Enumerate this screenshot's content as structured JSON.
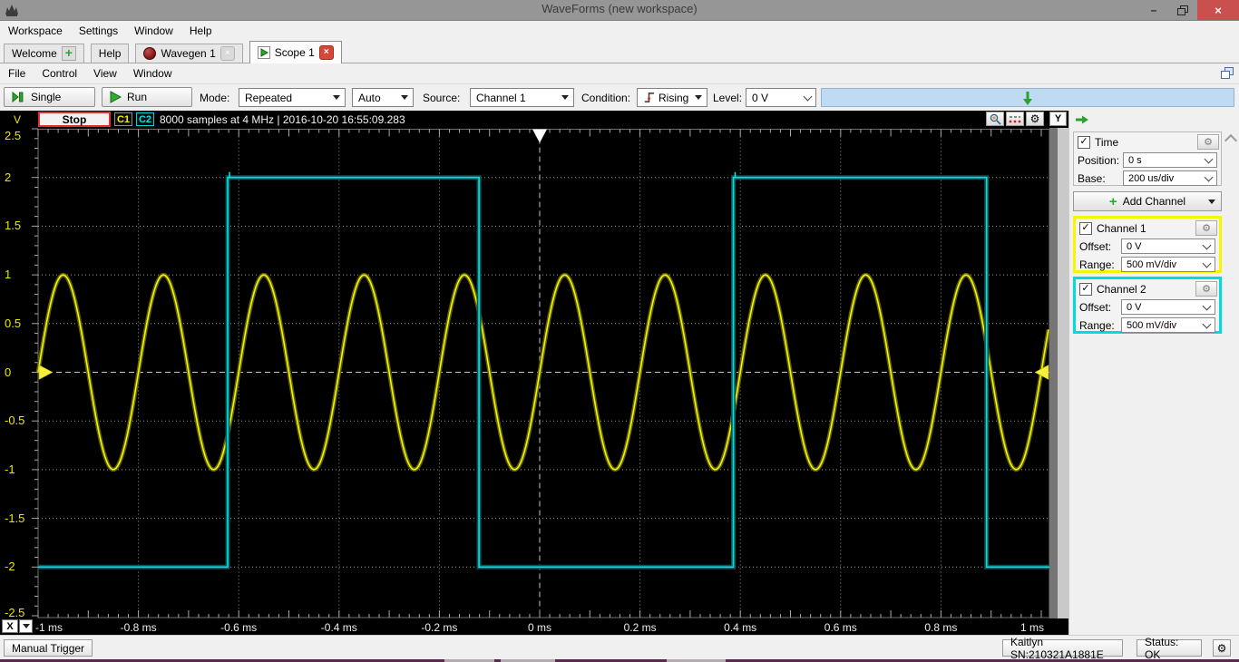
{
  "window": {
    "title": "WaveForms  (new workspace)"
  },
  "icons": {
    "gear": "⚙",
    "check": "✓",
    "plus": "+",
    "play": "▶",
    "close": "×",
    "minimize": "–",
    "dropdown": "▼"
  },
  "menubar": {
    "items": [
      "Workspace",
      "Settings",
      "Window",
      "Help"
    ]
  },
  "tabs": {
    "welcome": "Welcome",
    "help": "Help",
    "wavegen": "Wavegen 1",
    "scope": "Scope 1"
  },
  "scope_menu": {
    "items": [
      "File",
      "Control",
      "View",
      "Window"
    ]
  },
  "toolbar": {
    "single_label": "Single",
    "run_label": "Run",
    "mode_label": "Mode:",
    "mode_value": "Repeated",
    "trigger_mode_value": "Auto",
    "source_label": "Source:",
    "source_value": "Channel 1",
    "condition_label": "Condition:",
    "condition_value": "Rising",
    "level_label": "Level:",
    "level_value": "0 V"
  },
  "scope_header": {
    "stop_label": "Stop",
    "c1_label": "C1",
    "c2_label": "C2",
    "info": "8000 samples at 4 MHz | 2016-10-20 16:55:09.283"
  },
  "right_panel": {
    "time_label": "Time",
    "position_label": "Position:",
    "position_value": "0 s",
    "base_label": "Base:",
    "base_value": "200 us/div",
    "add_channel_label": "Add Channel",
    "ch1": {
      "label": "Channel 1",
      "offset_label": "Offset:",
      "offset_value": "0 V",
      "range_label": "Range:",
      "range_value": "500 mV/div",
      "color": "#f6f600"
    },
    "ch2": {
      "label": "Channel 2",
      "offset_label": "Offset:",
      "offset_value": "0 V",
      "range_label": "Range:",
      "range_value": "500 mV/div",
      "color": "#00dcdc"
    }
  },
  "statusbar": {
    "manual_trigger_label": "Manual Trigger",
    "device_label": "Kaitlyn SN:210321A1881E",
    "status_label": "Status: OK"
  },
  "chart_data": {
    "type": "line",
    "title": "Oscilloscope capture, 2 channels",
    "x_axis": {
      "unit": "ms",
      "min": -1,
      "max": 1,
      "divisions": 10,
      "axis_button": "X",
      "tick_labels": [
        "-1 ms",
        "-0.8 ms",
        "-0.6 ms",
        "-0.4 ms",
        "-0.2 ms",
        "0 ms",
        "0.2 ms",
        "0.4 ms",
        "0.6 ms",
        "0.8 ms",
        "1 ms"
      ]
    },
    "y_axis": {
      "unit": "V",
      "min": -2.5,
      "max": 2.5,
      "divisions": 10,
      "axis_button": "Y",
      "tick_labels": [
        "2.5",
        "2",
        "1.5",
        "1",
        "0.5",
        "0",
        "-0.5",
        "-1",
        "-1.5",
        "-2",
        "-2.5"
      ]
    },
    "grid": true,
    "trigger": {
      "source": "Channel 1",
      "condition": "Rising",
      "level_V": 0,
      "position_ms": 0
    },
    "acquisition": {
      "samples": 8000,
      "rate": "4 MHz",
      "timestamp": "2016-10-20 16:55:09.283"
    },
    "series": [
      {
        "name": "Channel 1",
        "color": "#f4f400",
        "waveform": "sine",
        "amplitude_V": 1,
        "frequency_Hz": 5000,
        "offset_V": 0,
        "zero_crossing_rising_ms": -1
      },
      {
        "name": "Channel 2",
        "color": "#00e2e2",
        "waveform": "square",
        "high_V": 2,
        "low_V": -2,
        "initial_level": "low",
        "rising_edges_ms": [
          -0.622,
          0.386
        ],
        "falling_edges_ms": [
          -0.121,
          0.891
        ]
      }
    ]
  }
}
